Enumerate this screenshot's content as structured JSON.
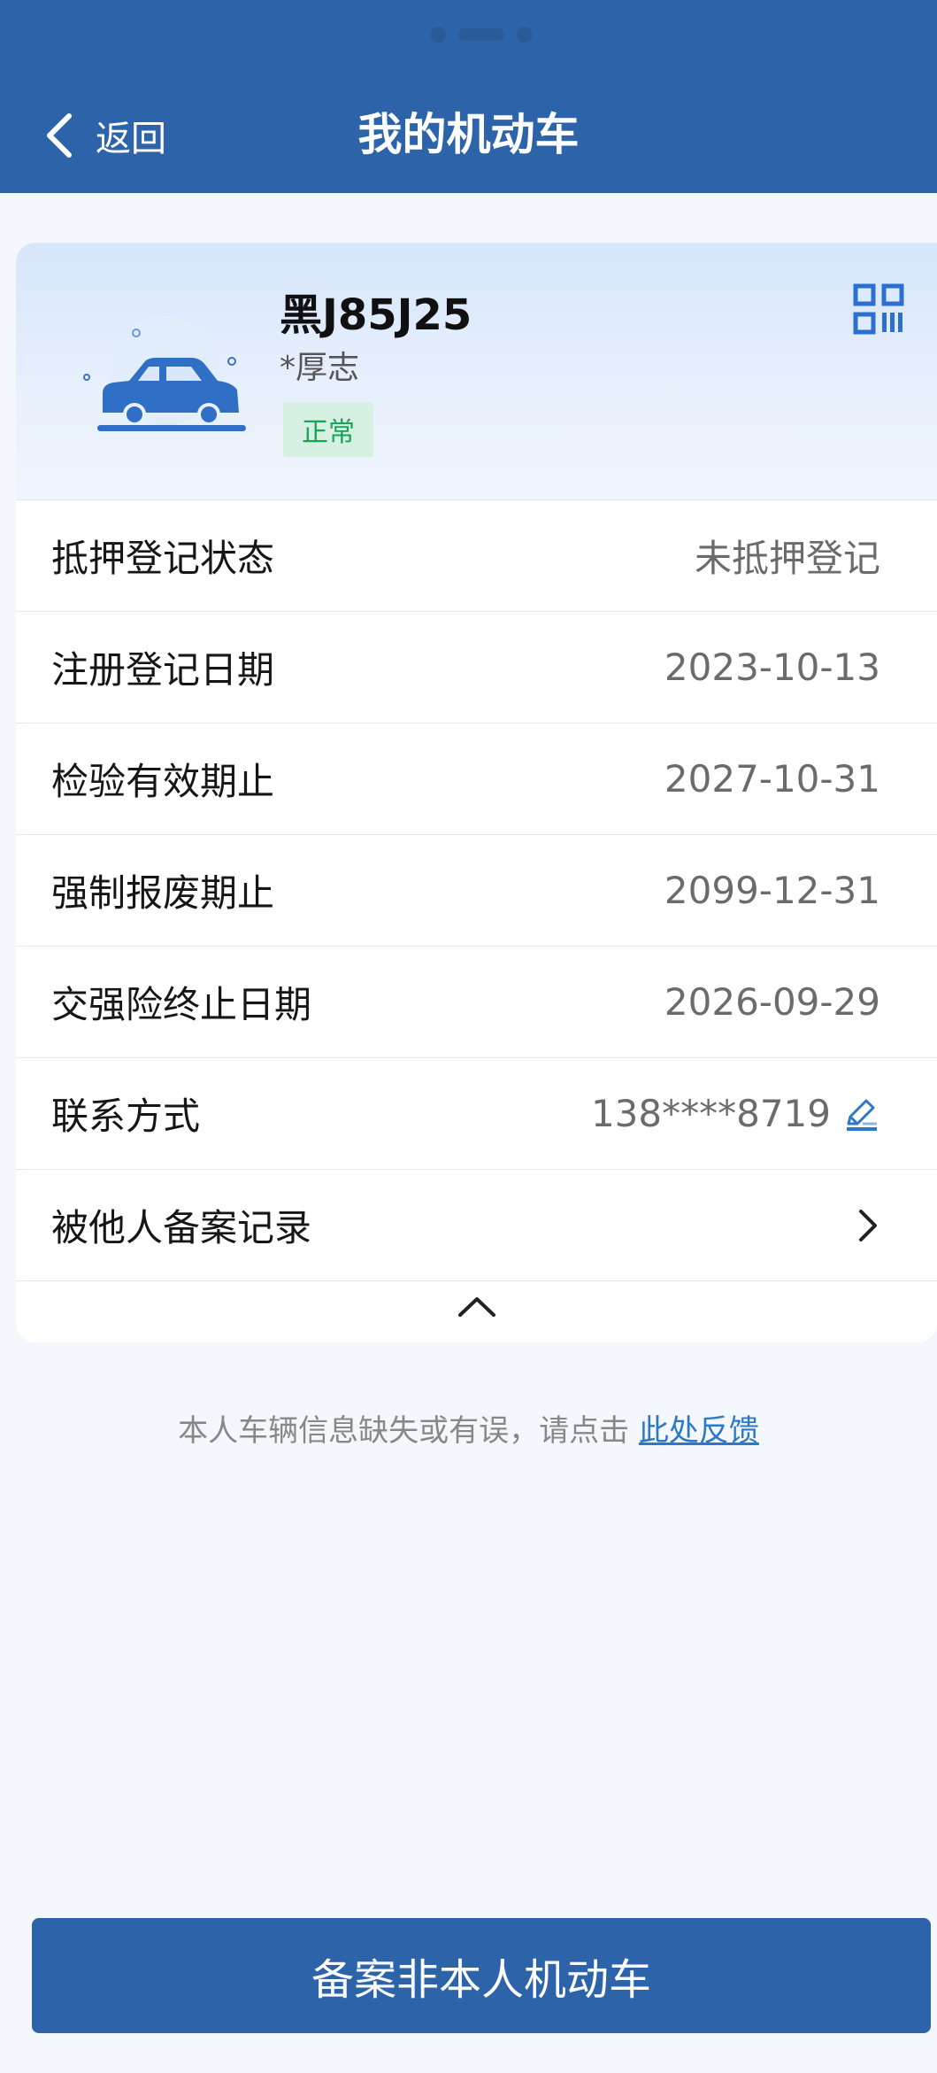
{
  "header": {
    "back_label": "返回",
    "title": "我的机动车"
  },
  "vehicle": {
    "plate": "黑J85J25",
    "owner": "*厚志",
    "status": "正常",
    "status_color": "#19a35a",
    "icons": [
      "car-illustration",
      "qr-code-icon"
    ]
  },
  "details": [
    {
      "label": "抵押登记状态",
      "value": "未抵押登记"
    },
    {
      "label": "注册登记日期",
      "value": "2023-10-13"
    },
    {
      "label": "检验有效期止",
      "value": "2027-10-31"
    },
    {
      "label": "强制报废期止",
      "value": "2099-12-31"
    },
    {
      "label": "交强险终止日期",
      "value": "2026-09-29"
    },
    {
      "label": "联系方式",
      "value": "138****8719",
      "icon": "edit-pencil-icon"
    },
    {
      "label": "被他人备案记录",
      "icon": "chevron-right-icon"
    }
  ],
  "feedback": {
    "text": "本人车辆信息缺失或有误，请点击",
    "link": "此处反馈"
  },
  "bottom_button": {
    "label": "备案非本人机动车"
  },
  "colors": {
    "brand_blue": "#2d64a9",
    "link_blue": "#2b78c9",
    "page_bg": "#f4f7fc"
  }
}
